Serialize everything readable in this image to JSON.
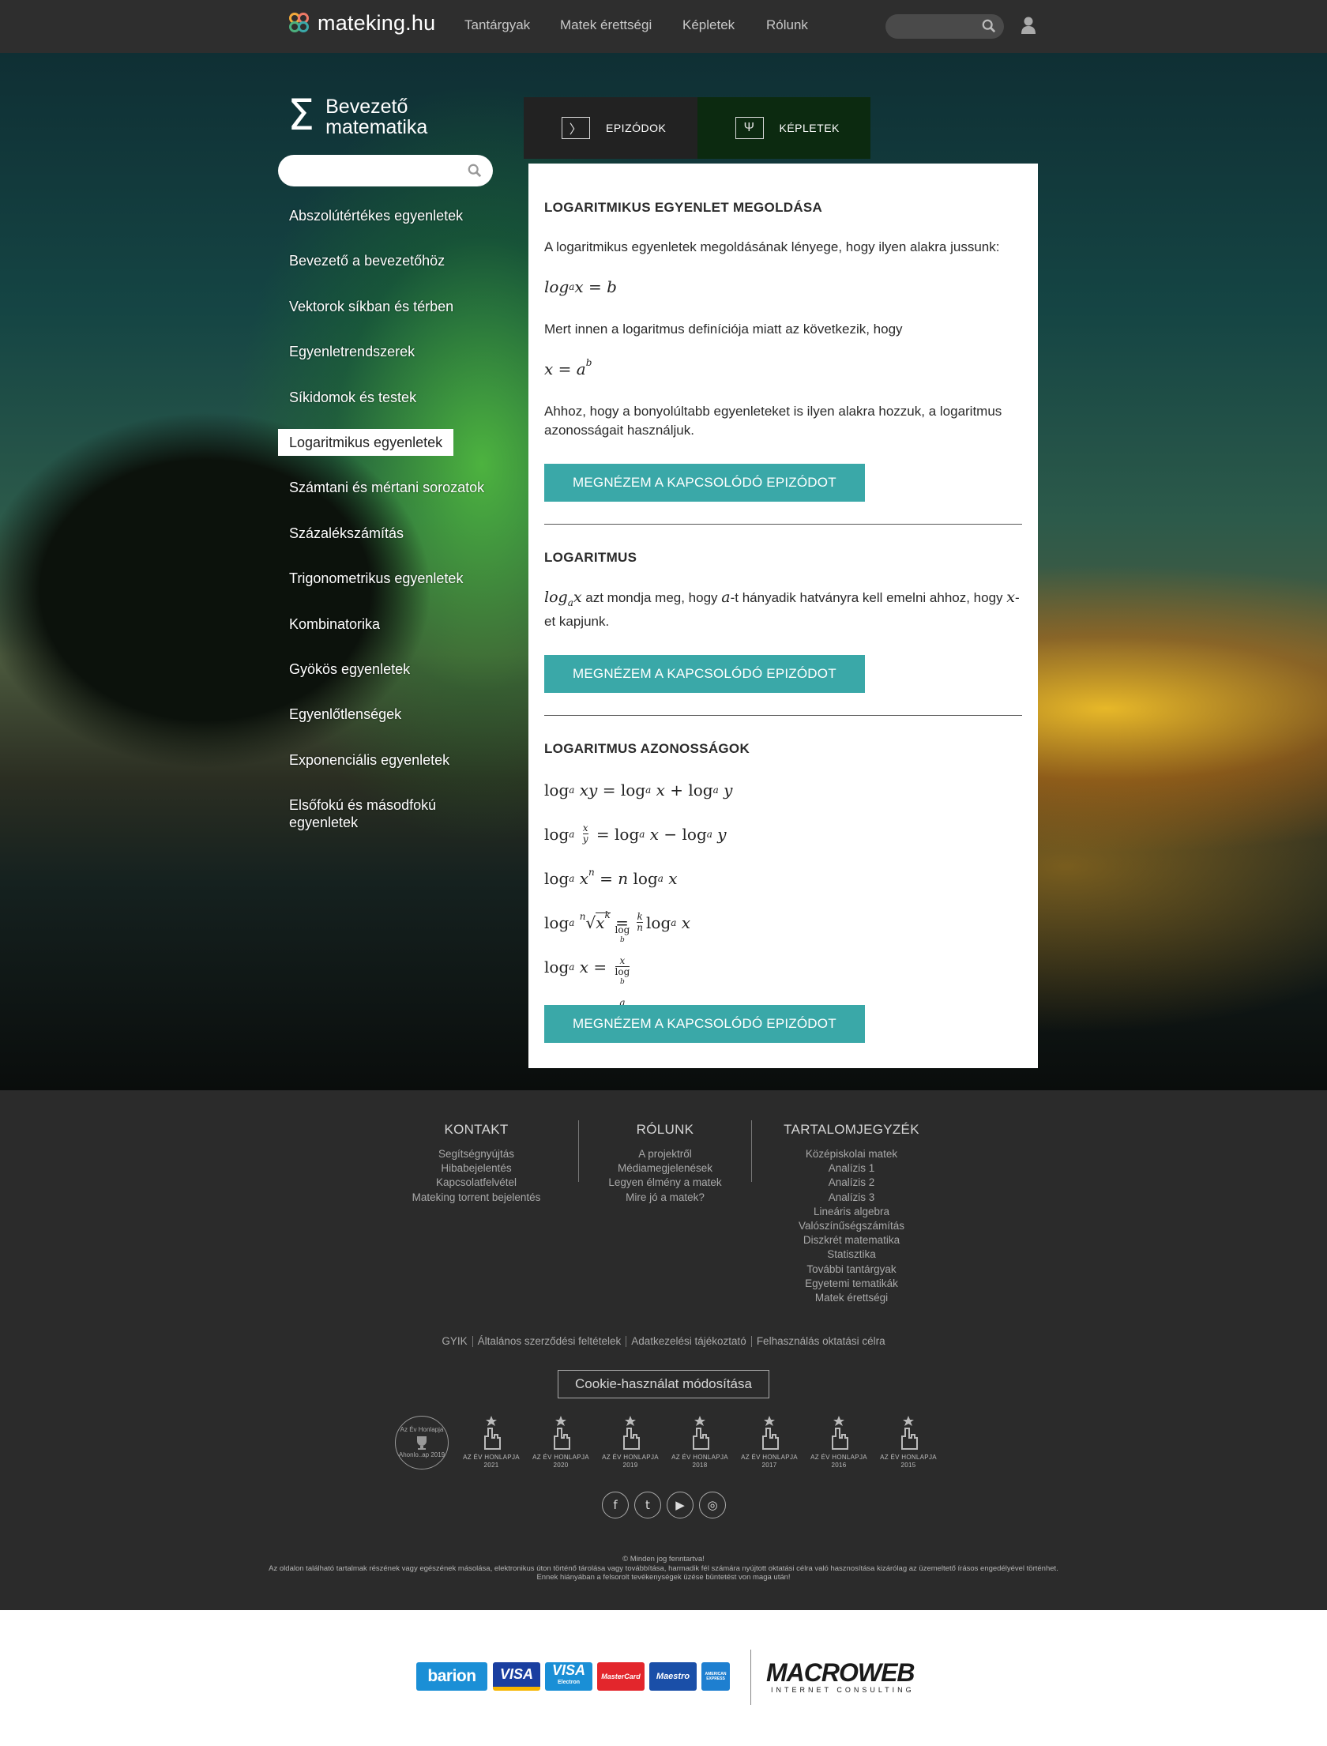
{
  "nav": {
    "brand": "mateking.hu",
    "links": [
      "Tantárgyak",
      "Matek érettségi",
      "Képletek",
      "Rólunk"
    ],
    "search_placeholder": "",
    "colorbar": [
      "#4caf7d",
      "#3aa8a8",
      "#3aa8a8",
      "#3aa8a8",
      "#f2a93b",
      "#f2a93b",
      "#ef7a67",
      "#ef7a67"
    ]
  },
  "course": {
    "symbol": "Σ",
    "title_line1": "Bevezető",
    "title_line2": "matematika",
    "search_placeholder": ""
  },
  "topics": [
    "Abszolútértékes egyenletek",
    "Bevezető a bevezetőhöz",
    "Vektorok síkban és térben",
    "Egyenletrendszerek",
    "Síkidomok és testek",
    "Logaritmikus egyenletek",
    "Számtani és mértani sorozatok",
    "Százalékszámítás",
    "Trigonometrikus egyenletek",
    "Kombinatorika",
    "Gyökös egyenletek",
    "Egyenlőtlenségek",
    "Exponenciális egyenletek",
    "Elsőfokú és másodfokú egyenletek"
  ],
  "active_topic_index": 5,
  "tabs": {
    "episodes": {
      "icon": "〉",
      "label": "EPIZÓDOK"
    },
    "formulas": {
      "icon": "Ψ",
      "label": "KÉPLETEK"
    }
  },
  "sections": [
    {
      "title": "LOGARITMIKUS EGYENLET MEGOLDÁSA",
      "intro": "A logaritmikus egyenletek megoldásának lényege, hogy ilyen alakra jussunk:",
      "middle": "Mert innen a logaritmus definíciója miatt az következik, hogy",
      "outro": "Ahhoz, hogy a bonyolúltabb egyenleteket is ilyen alakra hozzuk, a logaritmus azonosságait használjuk.",
      "button": "MEGNÉZEM A KAPCSOLÓDÓ EPIZÓDOT"
    },
    {
      "title": "LOGARITMUS",
      "text_a": " azt mondja meg, hogy ",
      "text_b": "-t hányadik hatványra kell emelni ahhoz, hogy ",
      "text_c": "-et kapjunk.",
      "button": "MEGNÉZEM A KAPCSOLÓDÓ EPIZÓDOT"
    },
    {
      "title": "LOGARITMUS AZONOSSÁGOK",
      "button": "MEGNÉZEM A KAPCSOLÓDÓ EPIZÓDOT"
    }
  ],
  "footer": {
    "contact": {
      "heading": "KONTAKT",
      "links": [
        "Segítségnyújtás",
        "Hibabejelentés",
        "Kapcsolatfelvétel",
        "Mateking torrent bejelentés"
      ]
    },
    "about": {
      "heading": "RÓLUNK",
      "links": [
        "A projektről",
        "Médiamegjelenések",
        "Legyen élmény a matek",
        "Mire jó a matek?"
      ]
    },
    "toc": {
      "heading": "TARTALOMJEGYZÉK",
      "links": [
        "Középiskolai matek",
        "Analízis 1",
        "Analízis 2",
        "Analízis 3",
        "Lineáris algebra",
        "Valószínűségszámítás",
        "Diszkrét matematika",
        "Statisztika",
        "További tantárgyak",
        "Egyetemi tematikák",
        "Matek érettségi"
      ]
    },
    "legal_links": [
      "GYIK",
      "Általános szerződési feltételek",
      "Adatkezelési tájékoztató",
      "Felhasználás oktatási célra"
    ],
    "cookie_button": "Cookie-használat módosítása",
    "award_round": {
      "top": "Az Év Honlapja",
      "bottom": "Ahonlo..ap 2019"
    },
    "awards": [
      {
        "label": "AZ ÉV HONLAPJA",
        "year": "2021"
      },
      {
        "label": "AZ ÉV HONLAPJA",
        "year": "2020"
      },
      {
        "label": "AZ ÉV HONLAPJA",
        "year": "2019"
      },
      {
        "label": "AZ ÉV HONLAPJA",
        "year": "2018"
      },
      {
        "label": "AZ ÉV HONLAPJA",
        "year": "2017"
      },
      {
        "label": "AZ ÉV HONLAPJA",
        "year": "2016"
      },
      {
        "label": "AZ ÉV HONLAPJA",
        "year": "2015"
      }
    ],
    "social": [
      {
        "icon": "facebook-icon",
        "glyph": "f"
      },
      {
        "icon": "twitter-icon",
        "glyph": "t"
      },
      {
        "icon": "youtube-icon",
        "glyph": "▶"
      },
      {
        "icon": "instagram-icon",
        "glyph": "◎"
      }
    ],
    "copyright": "© Minden jog fenntartva!",
    "disclaimer": "Az oldalon található tartalmak részének vagy egészének másolása, elektronikus úton történő tárolása vagy továbbítása, harmadik fél számára nyújtott oktatási célra való hasznosítása kizárólag az üzemeltető írásos engedélyével történhet. Ennek hiányában a felsorolt tevékenységek üzése büntetést von maga után!"
  },
  "partners": {
    "barion": "barion",
    "visa": "VISA",
    "visa_electron": "VISA",
    "visa_electron_sub": "Electron",
    "mastercard": "MasterCard",
    "maestro": "Maestro",
    "amex": "AMERICAN EXPRESS",
    "macroweb": "MACROWEB",
    "macroweb_sub": "INTERNET CONSULTING"
  }
}
